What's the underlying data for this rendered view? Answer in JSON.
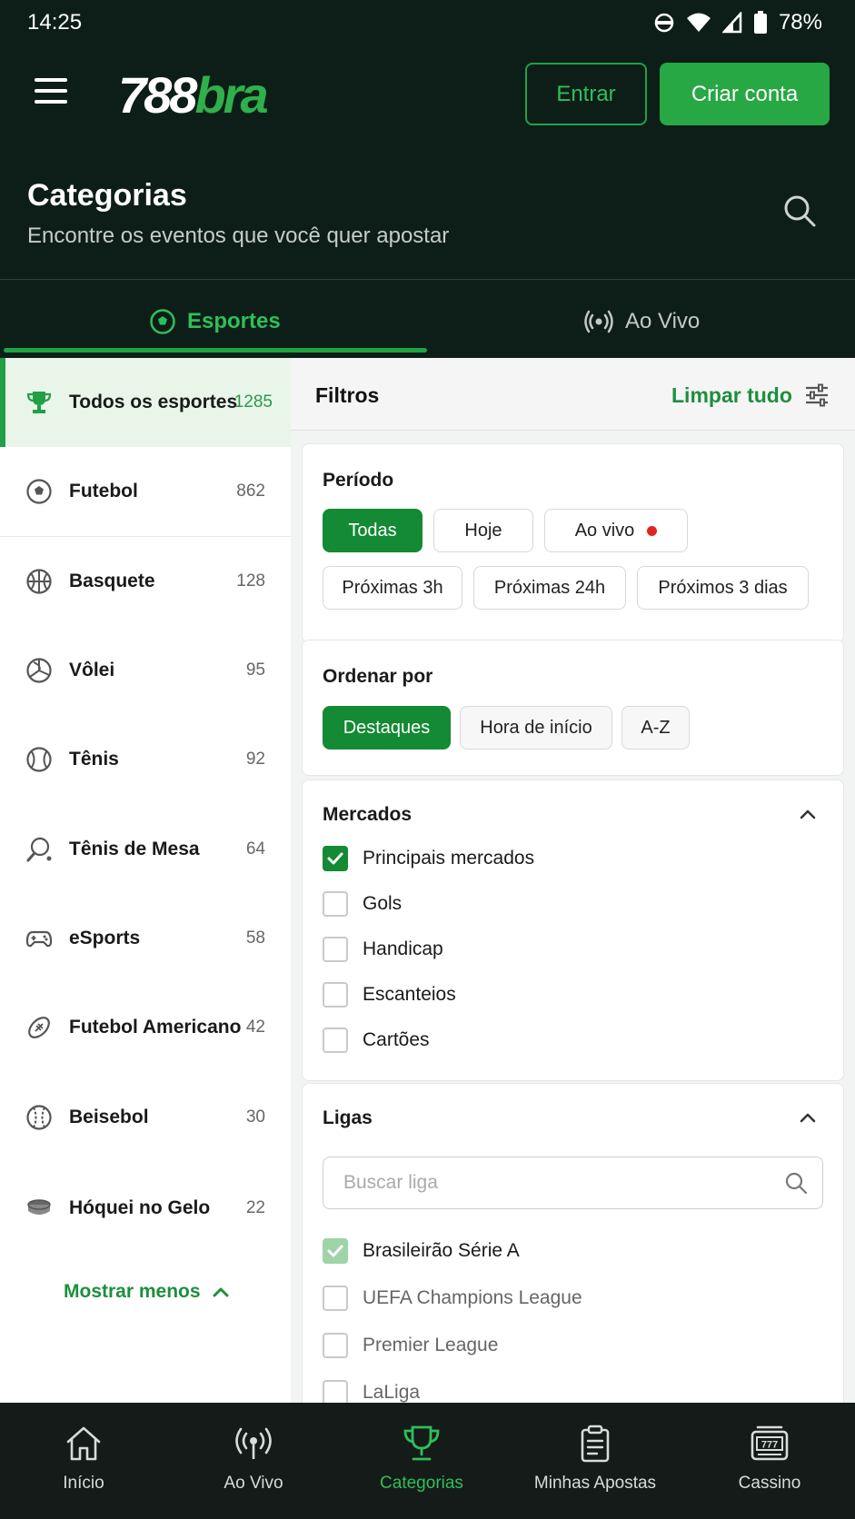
{
  "status": {
    "time": "14:25",
    "battery": "78%"
  },
  "header": {
    "logo_part1": "788",
    "logo_part2": "bra",
    "login_label": "Entrar",
    "signup_label": "Criar conta",
    "title": "Categorias",
    "subtitle": "Encontre os eventos que você quer apostar"
  },
  "tabs": [
    {
      "label": "Esportes",
      "icon": "soccer-ball-icon",
      "active": true
    },
    {
      "label": "Ao Vivo",
      "icon": "broadcast-icon",
      "active": false
    }
  ],
  "sports": [
    {
      "name": "Todos os esportes",
      "count": "1285",
      "icon": "trophy-icon",
      "active": true
    },
    {
      "name": "Futebol",
      "count": "862",
      "icon": "soccer-ball-icon"
    },
    {
      "name": "Basquete",
      "count": "128",
      "icon": "basketball-icon"
    },
    {
      "name": "Vôlei",
      "count": "95",
      "icon": "volleyball-icon"
    },
    {
      "name": "Tênis",
      "count": "92",
      "icon": "tennis-ball-icon"
    },
    {
      "name": "Tênis de Mesa",
      "count": "64",
      "icon": "table-tennis-icon"
    },
    {
      "name": "eSports",
      "count": "58",
      "icon": "gamepad-icon"
    },
    {
      "name": "Futebol Americano",
      "count": "42",
      "icon": "american-football-icon"
    },
    {
      "name": "Beisebol",
      "count": "30",
      "icon": "baseball-icon"
    },
    {
      "name": "Hóquei no Gelo",
      "count": "22",
      "icon": "hockey-puck-icon"
    }
  ],
  "show_less_label": "Mostrar menos",
  "filters": {
    "title": "Filtros",
    "clear_all": "Limpar tudo",
    "periodo": {
      "title": "Período",
      "options": [
        "Todas",
        "Hoje",
        "Ao vivo",
        "Próximas 3h",
        "Próximas 24h",
        "Próximos 3 dias"
      ],
      "selected": "Todas"
    },
    "ordenar": {
      "title": "Ordenar por",
      "options": [
        "Destaques",
        "Hora de início",
        "A-Z"
      ],
      "selected": "Destaques"
    },
    "mercados": {
      "title": "Mercados",
      "items": [
        {
          "label": "Principais mercados",
          "checked": true
        },
        {
          "label": "Gols",
          "checked": false
        },
        {
          "label": "Handicap",
          "checked": false
        },
        {
          "label": "Escanteios",
          "checked": false
        },
        {
          "label": "Cartões",
          "checked": false
        }
      ]
    },
    "ligas": {
      "title": "Ligas",
      "search_placeholder": "Buscar liga",
      "items": [
        {
          "label": "Brasileirão Série A",
          "checked": true
        },
        {
          "label": "UEFA Champions League",
          "checked": false
        },
        {
          "label": "Premier League",
          "checked": false
        },
        {
          "label": "LaLiga",
          "checked": false
        }
      ]
    }
  },
  "bottom_nav": [
    {
      "label": "Início",
      "icon": "home-icon"
    },
    {
      "label": "Ao Vivo",
      "icon": "broadcast-icon"
    },
    {
      "label": "Categorias",
      "icon": "trophy-icon",
      "active": true
    },
    {
      "label": "Minhas Apostas",
      "icon": "clipboard-icon"
    },
    {
      "label": "Cassino",
      "icon": "slot-machine-icon"
    }
  ],
  "colors": {
    "header_bg": "#0d1e18",
    "brand_green": "#27a844",
    "dark_green": "#138a33",
    "nav_bg": "#151b19",
    "live_red": "#e02424"
  }
}
